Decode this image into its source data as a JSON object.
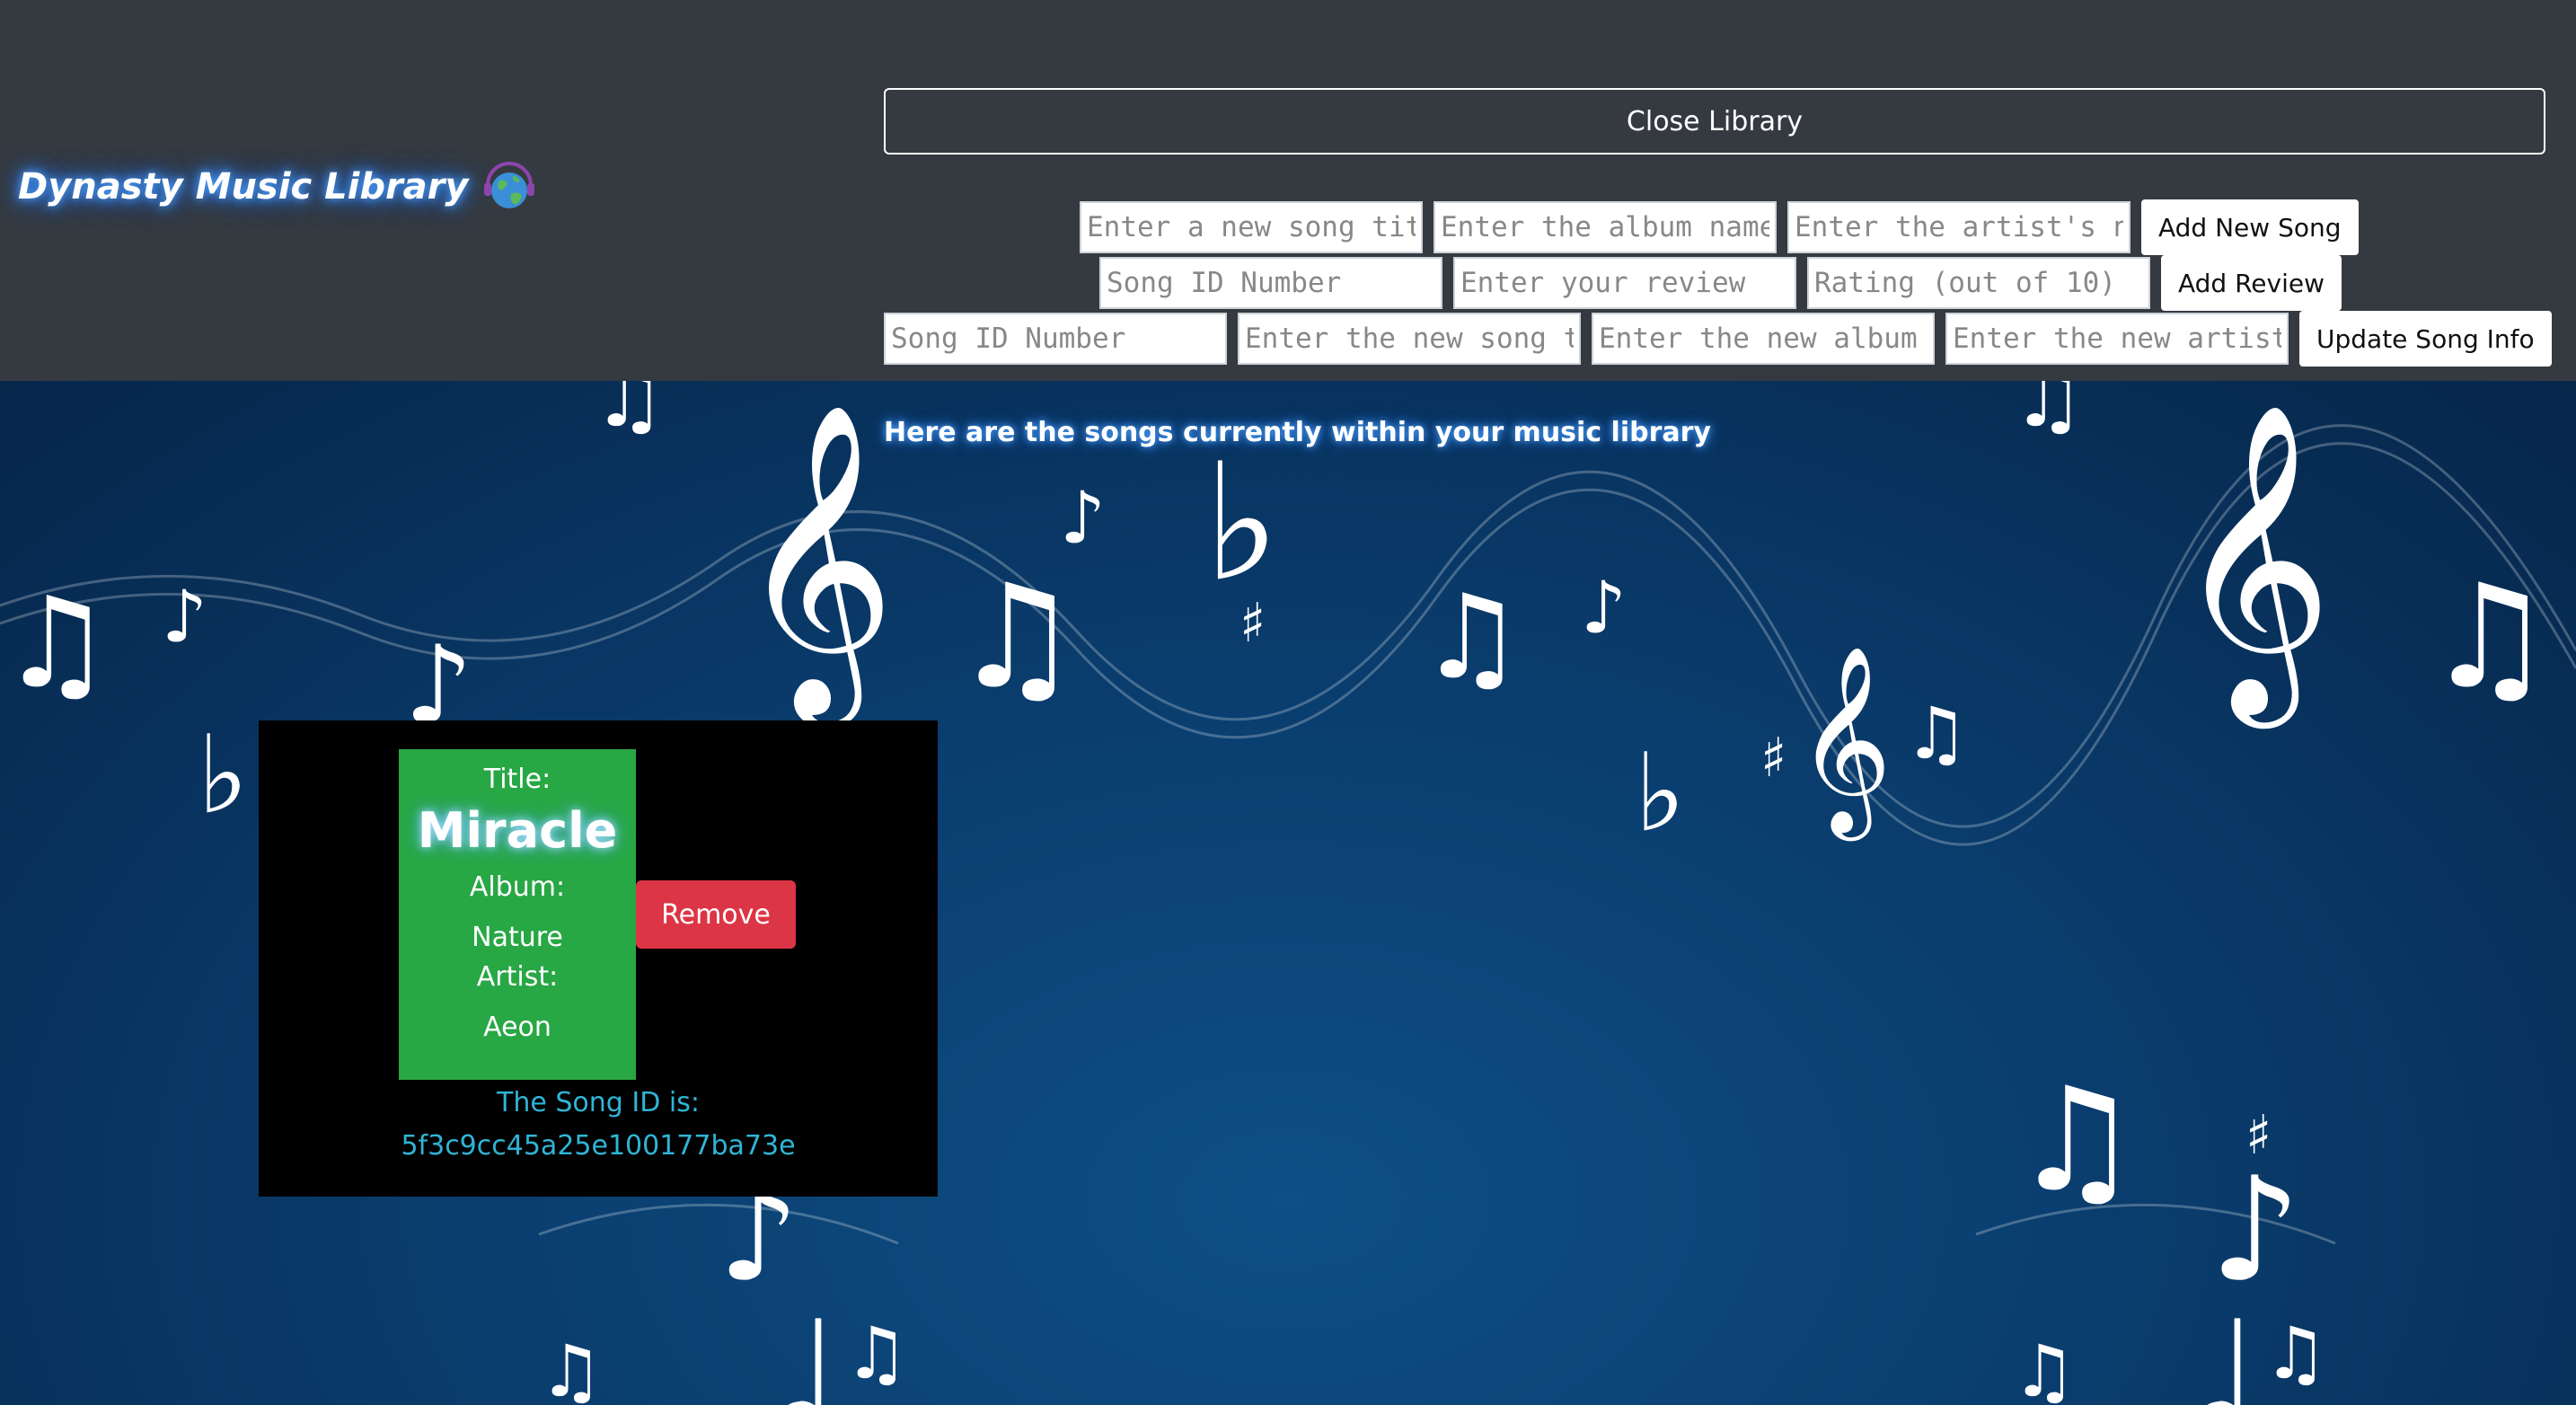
{
  "header": {
    "brand": "Dynasty Music Library",
    "brand_icon": "globe-icon",
    "close_library": "Close Library"
  },
  "add_song": {
    "title_placeholder": "Enter a new song title",
    "album_placeholder": "Enter the album name",
    "artist_placeholder": "Enter the artist's name",
    "button": "Add New Song"
  },
  "add_review": {
    "id_placeholder": "Song ID Number",
    "review_placeholder": "Enter your review",
    "rating_placeholder": "Rating (out of 10)",
    "button": "Add Review"
  },
  "update_song": {
    "id_placeholder": "Song ID Number",
    "title_placeholder": "Enter the new song title",
    "album_placeholder": "Enter the new album name",
    "artist_placeholder": "Enter the new artist name",
    "button": "Update Song Info"
  },
  "library": {
    "heading": "Here are the songs currently within your music library",
    "songs": [
      {
        "title_label": "Title:",
        "title": "Miracle",
        "album_label": "Album:",
        "album": "Nature",
        "artist_label": "Artist:",
        "artist": "Aeon",
        "remove": "Remove",
        "id_label": "The Song ID is:",
        "id": "5f3c9cc45a25e100177ba73e"
      }
    ]
  },
  "colors": {
    "header_bg": "#343a40",
    "song_card_bg": "#000000",
    "song_info_bg": "#28a745",
    "remove_bg": "#dc3545",
    "song_id_color": "#2fb5d6",
    "glow": "#4da3ff"
  }
}
